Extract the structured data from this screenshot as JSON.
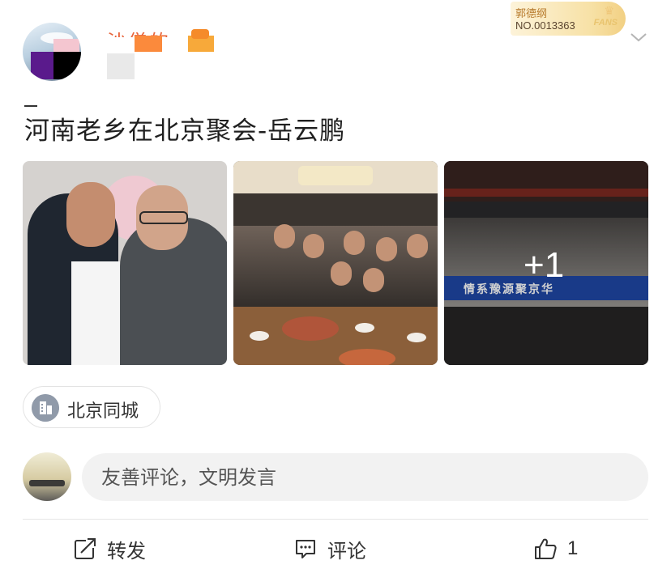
{
  "header": {
    "username": "沙僧的",
    "fans_badge": {
      "name": "郭德纲",
      "number": "NO.0013363",
      "label": "FANS"
    }
  },
  "post": {
    "text": "河南老乡在北京聚会-岳云鹏",
    "images": [
      {
        "name": "photo-two-men"
      },
      {
        "name": "photo-dinner-group"
      },
      {
        "name": "photo-group-banner",
        "banner_text": "情系豫源聚京华",
        "more_count": "+1"
      }
    ],
    "location": "北京同城"
  },
  "comment_box": {
    "placeholder": "友善评论，文明发言"
  },
  "actions": {
    "repost_label": "转发",
    "comment_label": "评论",
    "like_count": "1"
  },
  "colors": {
    "accent": "#e8643a",
    "badge_gold": "#f2d083",
    "banner_blue": "#1f47a6"
  }
}
